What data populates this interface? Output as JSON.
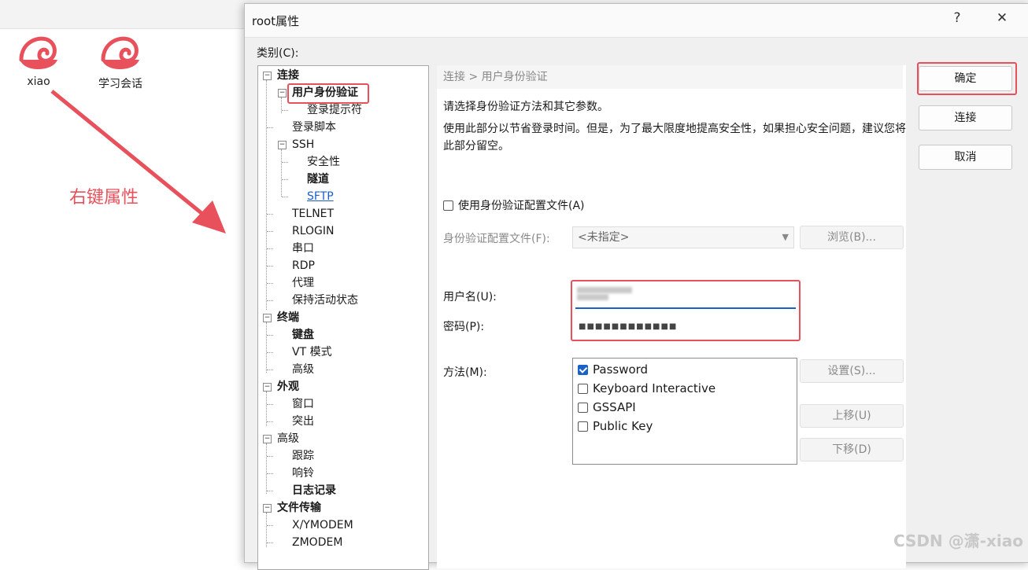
{
  "desktop": {
    "icons": [
      {
        "label": "xiao",
        "icon": "swirl-app-icon"
      },
      {
        "label": "学习会话",
        "icon": "swirl-app-icon"
      }
    ],
    "annotation": "右键属性",
    "accent_color": "#e8505b"
  },
  "dialog": {
    "title": "root属性",
    "help_label": "?",
    "close_label": "✕",
    "category_label": "类别(C):",
    "tree": [
      {
        "label": "连接"
      },
      {
        "label": "用户身份验证"
      },
      {
        "label": "登录提示符"
      },
      {
        "label": "登录脚本"
      },
      {
        "label": "SSH"
      },
      {
        "label": "安全性"
      },
      {
        "label": "隧道"
      },
      {
        "label": "SFTP"
      },
      {
        "label": "TELNET"
      },
      {
        "label": "RLOGIN"
      },
      {
        "label": "串口"
      },
      {
        "label": "RDP"
      },
      {
        "label": "代理"
      },
      {
        "label": "保持活动状态"
      },
      {
        "label": "终端"
      },
      {
        "label": "键盘"
      },
      {
        "label": "VT 模式"
      },
      {
        "label": "高级"
      },
      {
        "label": "外观"
      },
      {
        "label": "窗口"
      },
      {
        "label": "突出"
      },
      {
        "label": "高级"
      },
      {
        "label": "跟踪"
      },
      {
        "label": "响铃"
      },
      {
        "label": "日志记录"
      },
      {
        "label": "文件传输"
      },
      {
        "label": "X/YMODEM"
      },
      {
        "label": "ZMODEM"
      }
    ],
    "breadcrumb": "连接 > 用户身份验证",
    "description_1": "请选择身份验证方法和其它参数。",
    "description_2": "使用此部分以节省登录时间。但是，为了最大限度地提高安全性，如果担心安全问题，建议您将此部分留空。",
    "use_profile_label": "使用身份验证配置文件(A)",
    "profile_label": "身份验证配置文件(F):",
    "profile_value": "<未指定>",
    "browse_label": "浏览(B)...",
    "username_label": "用户名(U):",
    "password_label": "密码(P):",
    "password_mask": "■■■■■■■■■■■■",
    "method_label": "方法(M):",
    "methods": [
      {
        "label": "Password",
        "checked": true
      },
      {
        "label": "Keyboard Interactive",
        "checked": false
      },
      {
        "label": "GSSAPI",
        "checked": false
      },
      {
        "label": "Public Key",
        "checked": false
      }
    ],
    "settings_label": "设置(S)...",
    "move_up_label": "上移(U)",
    "move_down_label": "下移(D)",
    "ok_label": "确定",
    "connect_label": "连接",
    "cancel_label": "取消"
  },
  "watermark": "CSDN @潇-xiao"
}
